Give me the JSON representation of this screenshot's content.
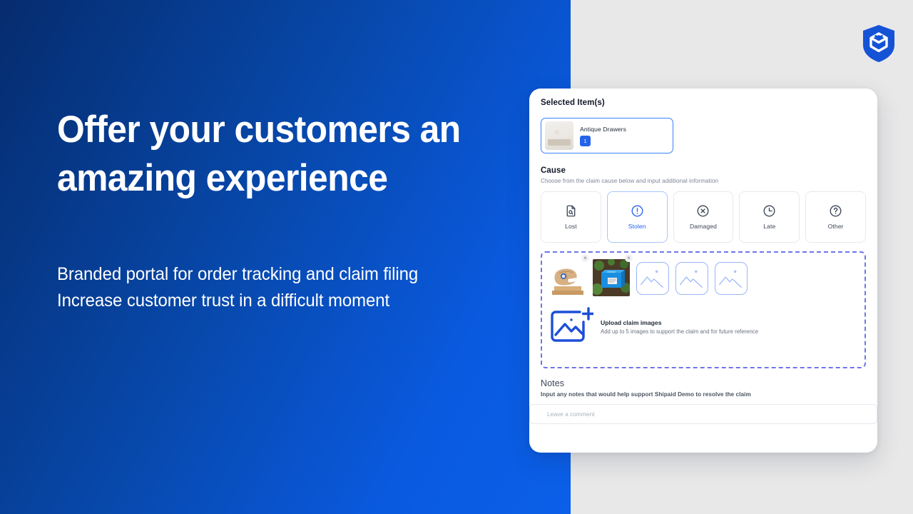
{
  "hero": {
    "headline": "Offer your customers an amazing experience",
    "subhead_line1": "Branded portal for order tracking and claim filing",
    "subhead_line2": "Increase customer trust in a difficult moment"
  },
  "brand": {
    "logo_icon": "shipaid-shield-box-logo",
    "accent_blue": "#1553d6",
    "panel_gradient_from": "#062c6e",
    "panel_gradient_to": "#0b5fe8",
    "right_bg": "#e8e8e8"
  },
  "card": {
    "selected_items": {
      "title": "Selected Item(s)",
      "items": [
        {
          "name": "Antique Drawers",
          "quantity": "1",
          "thumb_icon": "antique-drawers-thumbnail"
        }
      ]
    },
    "cause": {
      "title": "Cause",
      "subtitle": "Choose from the claim cause below and input additional information",
      "selected": "Stolen",
      "options": [
        {
          "label": "Lost",
          "icon": "document-search-icon",
          "selected": false
        },
        {
          "label": "Stolen",
          "icon": "exclamation-circle-icon",
          "selected": true
        },
        {
          "label": "Damaged",
          "icon": "x-circle-icon",
          "selected": false
        },
        {
          "label": "Late",
          "icon": "clock-icon",
          "selected": false
        },
        {
          "label": "Other",
          "icon": "question-circle-icon",
          "selected": false
        }
      ]
    },
    "upload": {
      "heading": "Upload claim images",
      "description": "Add up to 5 images to support the claim and for future reference",
      "add_icon": "add-image-icon",
      "uploaded": [
        {
          "alt": "damaged-brown-package-photo",
          "remove_label": "×"
        },
        {
          "alt": "blue-crate-on-soil-photo",
          "remove_label": "×"
        }
      ],
      "placeholders": [
        {
          "icon": "image-placeholder-icon"
        },
        {
          "icon": "image-placeholder-icon"
        },
        {
          "icon": "image-placeholder-icon"
        }
      ]
    },
    "notes": {
      "title": "Notes",
      "subtitle": "Input any notes that would help support Shipaid Demo to resolve the claim",
      "placeholder": "Leave a comment",
      "value": ""
    }
  }
}
